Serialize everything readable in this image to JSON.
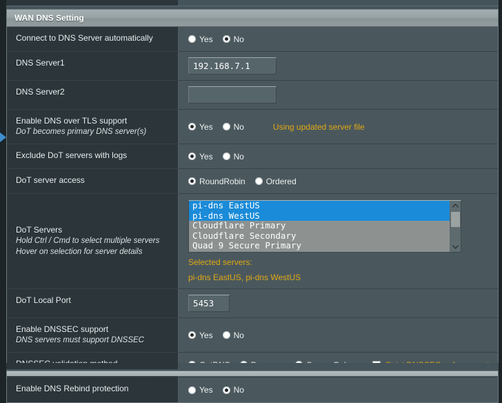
{
  "section": {
    "title": "WAN DNS Setting"
  },
  "rows": {
    "auto_dns": {
      "label": "Connect to DNS Server automatically",
      "options": [
        "Yes",
        "No"
      ],
      "selected": "No"
    },
    "dns_server1": {
      "label": "DNS Server1",
      "value": "192.168.7.1"
    },
    "dns_server2": {
      "label": "DNS Server2",
      "value": ""
    },
    "dot_support": {
      "label": "Enable DNS over TLS support",
      "sub": "DoT becomes primary DNS server(s)",
      "options": [
        "Yes",
        "No"
      ],
      "selected": "Yes",
      "note": "Using updated server file"
    },
    "exclude_logs": {
      "label": "Exclude DoT servers with logs",
      "options": [
        "Yes",
        "No"
      ],
      "selected": "Yes"
    },
    "server_access": {
      "label": "DoT server access",
      "options": [
        "RoundRobin",
        "Ordered"
      ],
      "selected": "RoundRobin"
    },
    "dot_servers": {
      "label": "DoT Servers",
      "sub1": "Hold Ctrl / Cmd to select multiple servers",
      "sub2": "Hover on selection for server details",
      "items": [
        {
          "name": "pi-dns EastUS",
          "selected": true
        },
        {
          "name": "pi-dns WestUS",
          "selected": true
        },
        {
          "name": "Cloudflare Primary",
          "selected": false
        },
        {
          "name": "Cloudflare Secondary",
          "selected": false
        },
        {
          "name": "Quad 9 Secure Primary",
          "selected": false
        }
      ],
      "selected_caption": "Selected servers:",
      "selected_value": "pi-dns EastUS, pi-dns WestUS"
    },
    "local_port": {
      "label": "DoT Local Port",
      "value": "5453"
    },
    "dnssec_support": {
      "label": "Enable DNSSEC support",
      "sub": "DNS servers must support DNSSEC",
      "options": [
        "Yes",
        "No"
      ],
      "selected": "Yes"
    },
    "dnssec_method": {
      "label": "DNSSEC validation method",
      "options": [
        "GetDNS",
        "Dnsmasq",
        "Server Only"
      ],
      "selected": "Dnsmasq",
      "checkbox_label": "Strict DNSSEC enforcement",
      "checkbox_checked": true
    },
    "rebind": {
      "label": "Enable DNS Rebind protection",
      "options": [
        "Yes",
        "No"
      ],
      "selected": "No"
    }
  },
  "colors": {
    "accent_amber": "#e0a815",
    "selection_blue": "#1a8bd8",
    "label_column": "#2b353a",
    "value_column": "#4a585d"
  }
}
